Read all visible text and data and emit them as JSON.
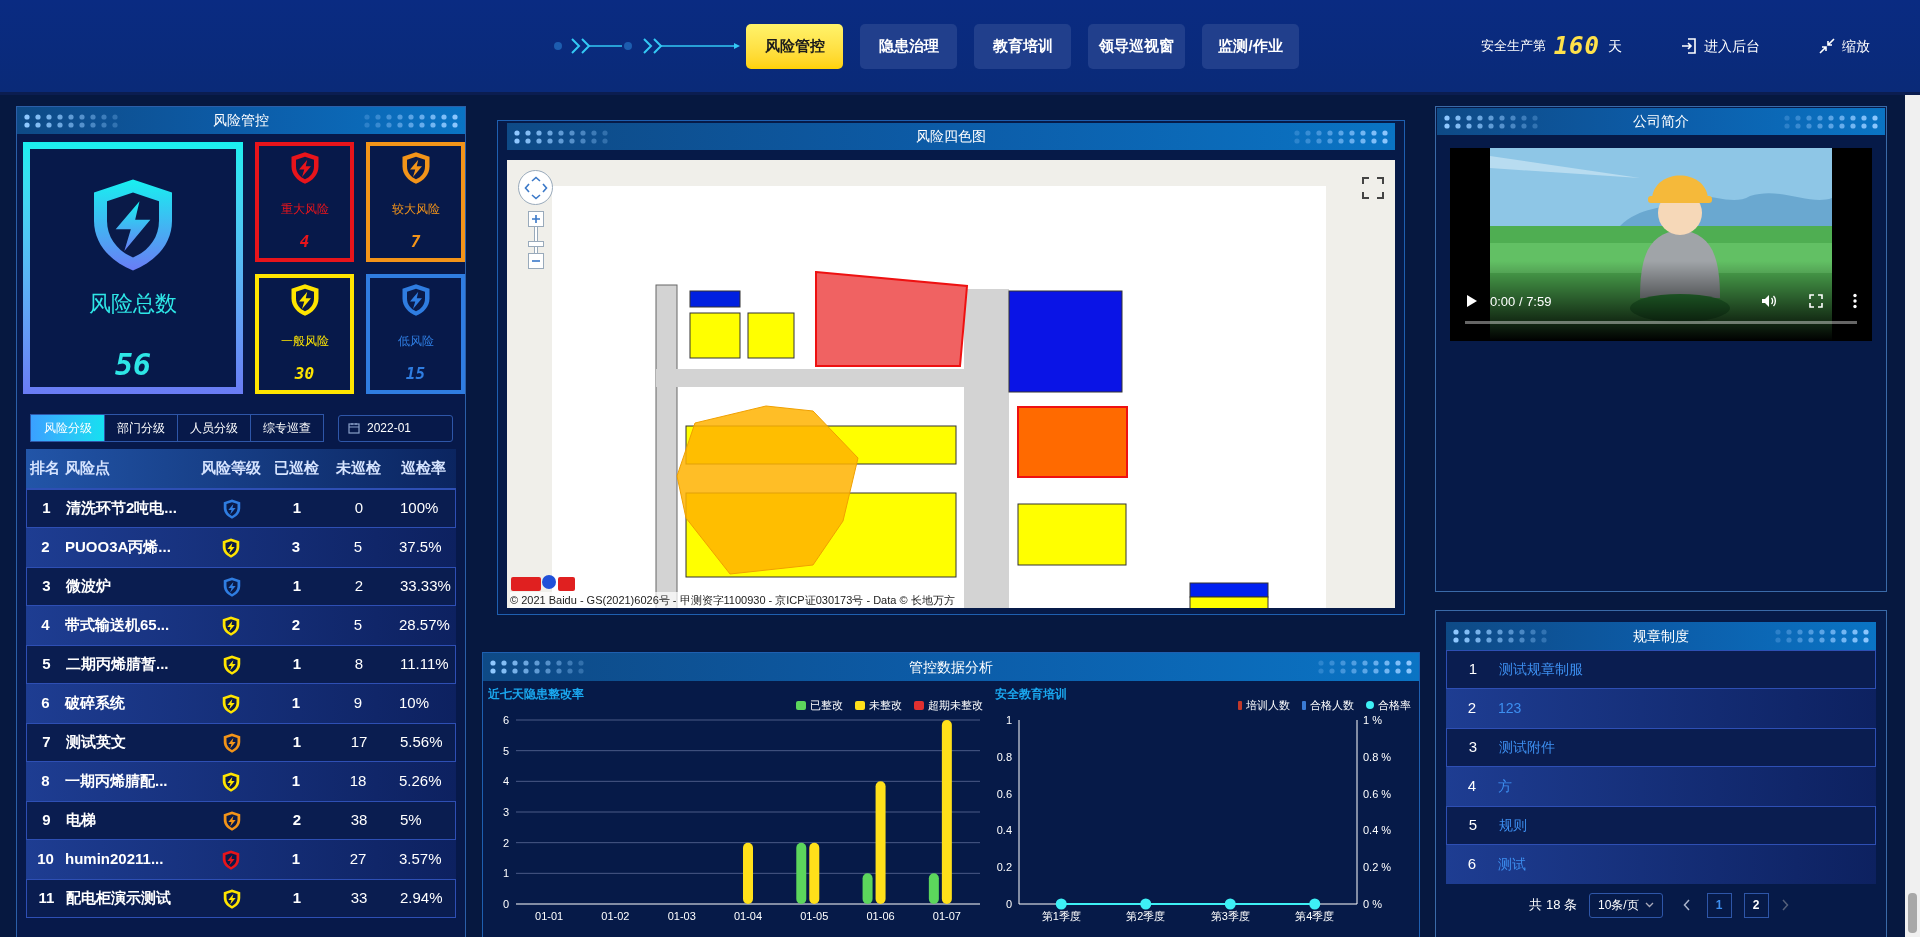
{
  "header": {
    "nav": [
      {
        "label": "风险管控",
        "selected": true
      },
      {
        "label": "隐患治理",
        "selected": false
      },
      {
        "label": "教育培训",
        "selected": false
      },
      {
        "label": "领导巡视窗",
        "selected": false
      },
      {
        "label": "监测/作业",
        "selected": false
      }
    ],
    "safety_days": {
      "prefix": "安全生产第",
      "value": "160",
      "suffix": "天"
    },
    "actions": [
      {
        "label": "进入后台",
        "kind": "enter"
      },
      {
        "label": "缩放",
        "kind": "shrink"
      }
    ]
  },
  "risk_panel": {
    "title": "风险管控",
    "total": {
      "label": "风险总数",
      "value": "56"
    },
    "levels": [
      {
        "label": "重大风险",
        "value": "4",
        "color": "#e8141b"
      },
      {
        "label": "较大风险",
        "value": "7",
        "color": "#f39419"
      },
      {
        "label": "一般风险",
        "value": "30",
        "color": "#ffe500"
      },
      {
        "label": "低风险",
        "value": "15",
        "color": "#2f7de1"
      }
    ],
    "tabs": [
      {
        "label": "风险分级",
        "selected": true
      },
      {
        "label": "部门分级",
        "selected": false
      },
      {
        "label": "人员分级",
        "selected": false
      },
      {
        "label": "综专巡查",
        "selected": false
      }
    ],
    "date": "2022-01",
    "table": {
      "columns": [
        "排名",
        "风险点",
        "风险等级",
        "已巡检",
        "未巡检",
        "巡检率"
      ],
      "rows": [
        {
          "rank": "1",
          "name": "清洗环节2吨电...",
          "color": "#2f7de1",
          "checked": "1",
          "unchecked": "0",
          "rate": "100%"
        },
        {
          "rank": "2",
          "name": "PUOO3A丙烯...",
          "color": "#ffe500",
          "checked": "3",
          "unchecked": "5",
          "rate": "37.5%"
        },
        {
          "rank": "3",
          "name": "微波炉",
          "color": "#2f7de1",
          "checked": "1",
          "unchecked": "2",
          "rate": "33.33%"
        },
        {
          "rank": "4",
          "name": "带式输送机65...",
          "color": "#ffe500",
          "checked": "2",
          "unchecked": "5",
          "rate": "28.57%"
        },
        {
          "rank": "5",
          "name": "二期丙烯腈暂...",
          "color": "#ffe500",
          "checked": "1",
          "unchecked": "8",
          "rate": "11.11%"
        },
        {
          "rank": "6",
          "name": "破碎系统",
          "color": "#ffe500",
          "checked": "1",
          "unchecked": "9",
          "rate": "10%"
        },
        {
          "rank": "7",
          "name": "测试英文",
          "color": "#f39419",
          "checked": "1",
          "unchecked": "17",
          "rate": "5.56%"
        },
        {
          "rank": "8",
          "name": "一期丙烯腈配...",
          "color": "#ffe500",
          "checked": "1",
          "unchecked": "18",
          "rate": "5.26%"
        },
        {
          "rank": "9",
          "name": "电梯",
          "color": "#f39419",
          "checked": "2",
          "unchecked": "38",
          "rate": "5%"
        },
        {
          "rank": "10",
          "name": "humin20211...",
          "color": "#e8141b",
          "checked": "1",
          "unchecked": "27",
          "rate": "3.57%"
        },
        {
          "rank": "11",
          "name": "配电柜演示测试",
          "color": "#ffe500",
          "checked": "1",
          "unchecked": "33",
          "rate": "2.94%"
        }
      ]
    }
  },
  "map_panel": {
    "title": "风险四色图",
    "copyright": "© 2021 Baidu - GS(2021)6026号 - 甲测资字1100930 - 京ICP证030173号 - Data © 长地万方"
  },
  "analysis_panel": {
    "title": "管控数据分析",
    "charts": [
      {
        "title": "近七天隐患整改率",
        "chart_data": {
          "type": "bar",
          "grid": true,
          "legend": "top-right",
          "categories": [
            "01-01",
            "01-02",
            "01-03",
            "01-04",
            "01-05",
            "01-06",
            "01-07"
          ],
          "ylim": [
            0,
            6
          ],
          "yticks": [
            0,
            1,
            2,
            3,
            4,
            5,
            6
          ],
          "series": [
            {
              "name": "已整改",
              "color": "#5cd65c",
              "values": [
                0,
                0,
                0,
                0,
                2,
                1,
                1
              ]
            },
            {
              "name": "未整改",
              "color": "#ffe01a",
              "values": [
                0,
                0,
                0,
                2,
                2,
                4,
                6
              ]
            },
            {
              "name": "超期未整改",
              "color": "#e03030",
              "values": [
                0,
                0,
                0,
                0,
                0,
                0,
                0
              ]
            }
          ]
        }
      },
      {
        "title": "安全教育培训",
        "chart_data": {
          "type": "bar",
          "legend": "top-right",
          "y2lim": [
            0,
            1
          ],
          "categories": [
            "第1季度",
            "第2季度",
            "第3季度",
            "第4季度"
          ],
          "ylim": [
            0,
            1
          ],
          "yticks": [
            0,
            0.2,
            0.4,
            0.6,
            0.8,
            1
          ],
          "y2ticks": [
            {
              "value": 0,
              "label": "0 %"
            },
            {
              "value": 0.2,
              "label": "0.2 %"
            },
            {
              "value": 0.4,
              "label": "0.4 %"
            },
            {
              "value": 0.6,
              "label": "0.6 %"
            },
            {
              "value": 0.8,
              "label": "0.8 %"
            },
            {
              "value": 1,
              "label": "1 %"
            }
          ],
          "series": [
            {
              "name": "培训人数",
              "type": "bar",
              "color": "#c0392b",
              "values": [
                0,
                0,
                0,
                0
              ]
            },
            {
              "name": "合格人数",
              "type": "bar",
              "color": "#3a7bd5",
              "values": [
                0,
                0,
                0,
                0
              ]
            },
            {
              "name": "合格率",
              "type": "line",
              "marker": "circle",
              "color": "#3ef0f5",
              "values": [
                0,
                0,
                0,
                0
              ]
            }
          ]
        }
      }
    ]
  },
  "company_panel": {
    "title": "公司简介",
    "video": {
      "time": "0:00 / 7:59"
    }
  },
  "rules_panel": {
    "title": "规章制度",
    "rows": [
      {
        "index": "1",
        "title": "测试规章制服"
      },
      {
        "index": "2",
        "title": "123"
      },
      {
        "index": "3",
        "title": "测试附件"
      },
      {
        "index": "4",
        "title": "方"
      },
      {
        "index": "5",
        "title": "规则"
      },
      {
        "index": "6",
        "title": "测试"
      }
    ],
    "pagination": {
      "total": "共 18 条",
      "page_size": "10条/页",
      "pages": [
        {
          "label": "1",
          "selected": true
        },
        {
          "label": "2",
          "selected": false
        }
      ]
    }
  }
}
